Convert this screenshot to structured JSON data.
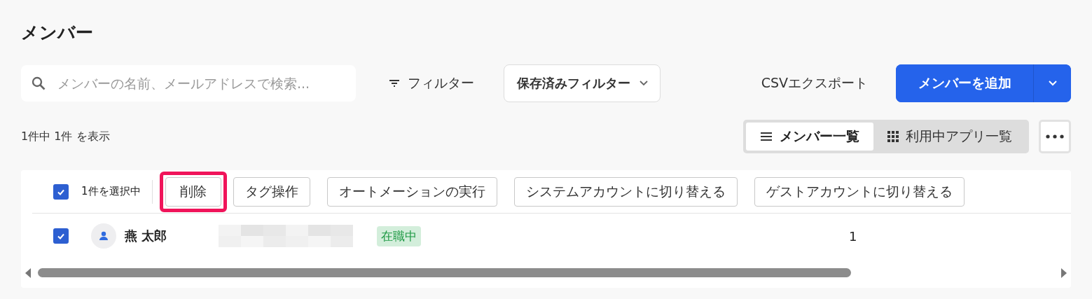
{
  "page_title": "メンバー",
  "search": {
    "placeholder": "メンバーの名前、メールアドレスで検索..."
  },
  "filter_button": "フィルター",
  "saved_filter": "保存済みフィルター",
  "csv_export": "CSVエクスポート",
  "add_button": "メンバーを追加",
  "result_count": "1件中 1件 を表示",
  "view_tabs": [
    {
      "label": "メンバー一覧",
      "kind": "list",
      "selected": true
    },
    {
      "label": "利用中アプリ一覧",
      "kind": "grid",
      "selected": false
    }
  ],
  "bulk_bar": {
    "checked": true,
    "selection_text": "1件を選択中",
    "actions": [
      {
        "label": "削除",
        "highlighted": true
      },
      {
        "label": "タグ操作",
        "highlighted": false
      },
      {
        "label": "オートメーションの実行",
        "highlighted": false
      },
      {
        "label": "システムアカウントに切り替える",
        "highlighted": false
      },
      {
        "label": "ゲストアカウントに切り替える",
        "highlighted": false
      }
    ]
  },
  "rows": [
    {
      "selected": true,
      "name": "燕 太郎",
      "status": "在職中",
      "column_5": "1"
    }
  ]
}
